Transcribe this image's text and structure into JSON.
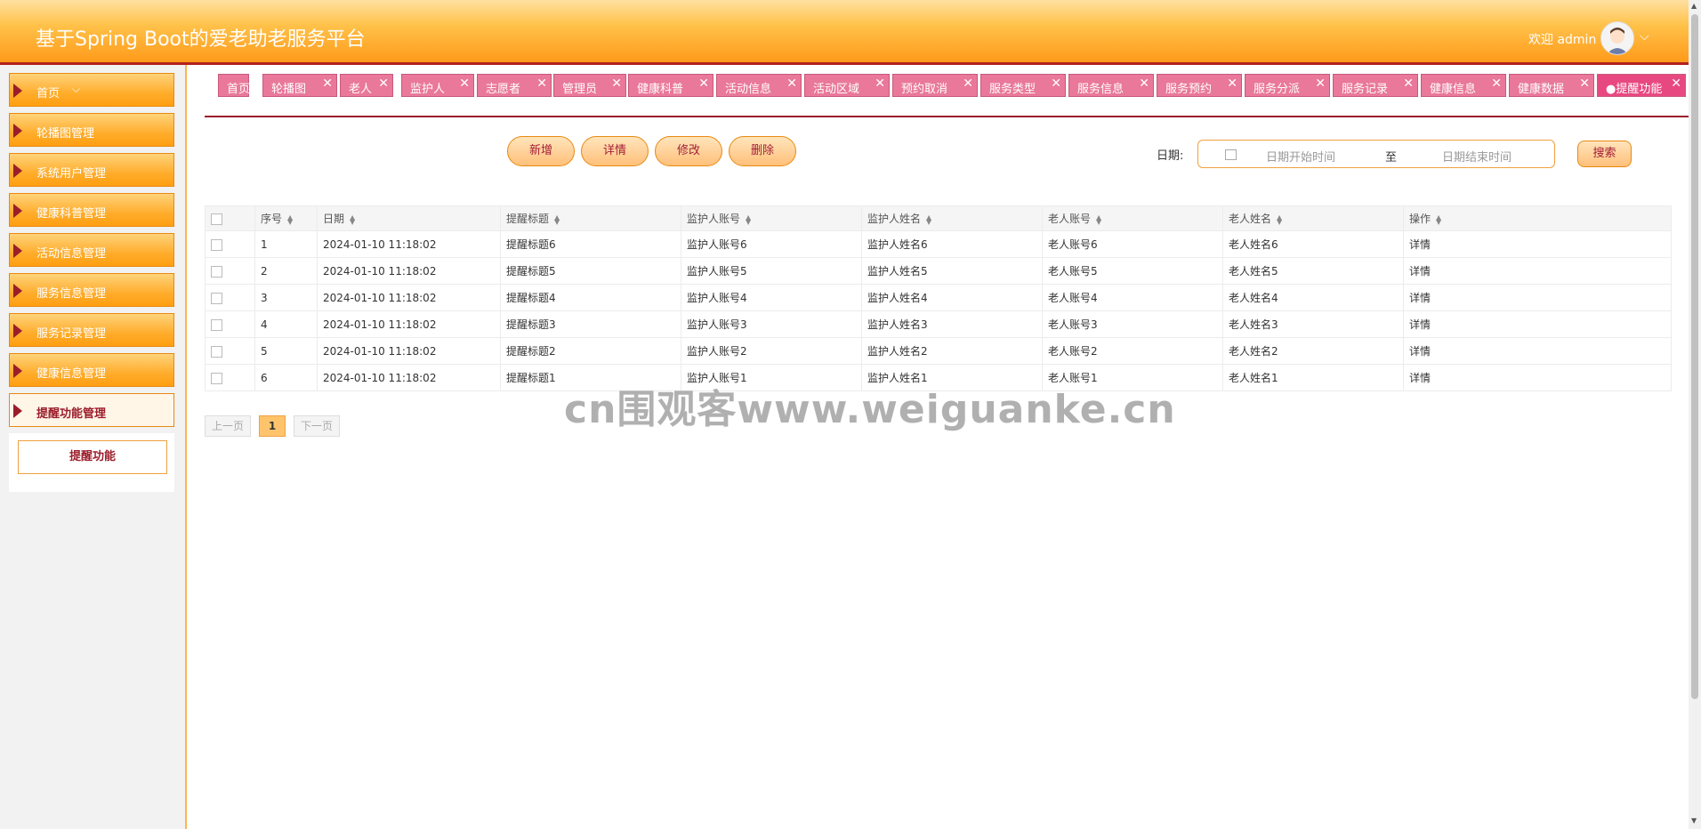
{
  "header": {
    "title": "基于Spring Boot的爱老助老服务平台",
    "welcome": "欢迎 admin",
    "dropdown_icon": "chevron-down-icon"
  },
  "sidebar": {
    "items": [
      {
        "label": "首页"
      },
      {
        "label": "轮播图管理"
      },
      {
        "label": "系统用户管理"
      },
      {
        "label": "健康科普管理"
      },
      {
        "label": "活动信息管理"
      },
      {
        "label": "服务信息管理"
      },
      {
        "label": "服务记录管理"
      },
      {
        "label": "健康信息管理"
      },
      {
        "label": "提醒功能管理"
      }
    ],
    "sub_item": "提醒功能"
  },
  "tabs": [
    {
      "label": "首页"
    },
    {
      "label": "轮播图"
    },
    {
      "label": "老人"
    },
    {
      "label": "监护人"
    },
    {
      "label": "志愿者"
    },
    {
      "label": "管理员"
    },
    {
      "label": "健康科普"
    },
    {
      "label": "活动信息"
    },
    {
      "label": "活动区域"
    },
    {
      "label": "预约取消"
    },
    {
      "label": "服务类型"
    },
    {
      "label": "服务信息"
    },
    {
      "label": "服务预约"
    },
    {
      "label": "服务分派"
    },
    {
      "label": "服务记录"
    },
    {
      "label": "健康信息"
    },
    {
      "label": "健康数据"
    },
    {
      "label": "●提醒功能"
    }
  ],
  "toolbar": {
    "add": "新增",
    "detail": "详情",
    "edit": "修改",
    "delete": "删除",
    "date_label": "日期:",
    "date_start_placeholder": "日期开始时间",
    "date_sep": "至",
    "date_end_placeholder": "日期结束时间",
    "search": "搜索"
  },
  "table": {
    "columns": [
      "序号",
      "日期",
      "提醒标题",
      "监护人账号",
      "监护人姓名",
      "老人账号",
      "老人姓名",
      "操作"
    ],
    "rows": [
      [
        "1",
        "2024-01-10 11:18:02",
        "提醒标题6",
        "监护人账号6",
        "监护人姓名6",
        "老人账号6",
        "老人姓名6",
        "详情"
      ],
      [
        "2",
        "2024-01-10 11:18:02",
        "提醒标题5",
        "监护人账号5",
        "监护人姓名5",
        "老人账号5",
        "老人姓名5",
        "详情"
      ],
      [
        "3",
        "2024-01-10 11:18:02",
        "提醒标题4",
        "监护人账号4",
        "监护人姓名4",
        "老人账号4",
        "老人姓名4",
        "详情"
      ],
      [
        "4",
        "2024-01-10 11:18:02",
        "提醒标题3",
        "监护人账号3",
        "监护人姓名3",
        "老人账号3",
        "老人姓名3",
        "详情"
      ],
      [
        "5",
        "2024-01-10 11:18:02",
        "提醒标题2",
        "监护人账号2",
        "监护人姓名2",
        "老人账号2",
        "老人姓名2",
        "详情"
      ],
      [
        "6",
        "2024-01-10 11:18:02",
        "提醒标题1",
        "监护人账号1",
        "监护人姓名1",
        "老人账号1",
        "老人姓名1",
        "详情"
      ]
    ]
  },
  "pagination": {
    "prev": "上一页",
    "current": "1",
    "next": "下一页"
  },
  "watermark": "cn围观客www.weiguanke.cn",
  "colors": {
    "accent": "#ff9f12",
    "tab": "#e9789a",
    "brand_red": "#9b1d2a"
  }
}
